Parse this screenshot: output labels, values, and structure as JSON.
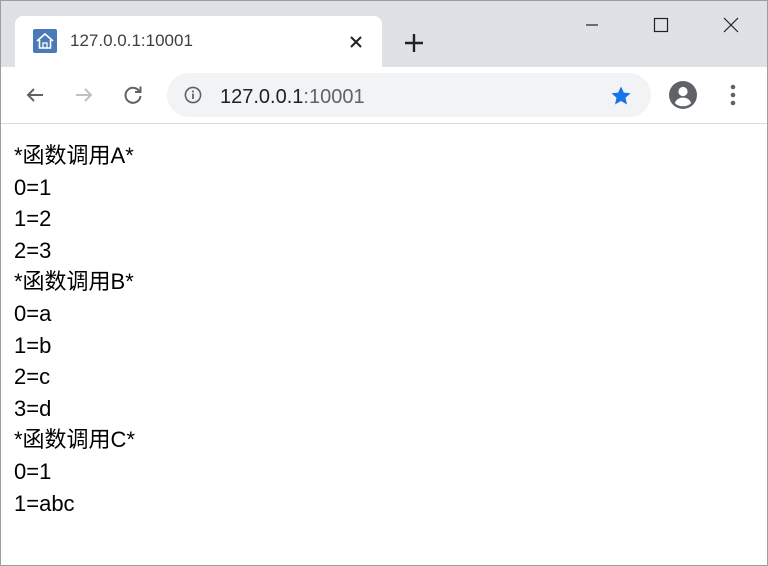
{
  "browser": {
    "tab": {
      "title": "127.0.0.1:10001",
      "favicon": "home-icon",
      "close_glyph": "✕"
    },
    "new_tab_icon": "plus-icon",
    "window_controls": [
      "minimize-icon",
      "maximize-icon",
      "close-icon"
    ],
    "toolbar": {
      "back_icon": "arrow-left-icon",
      "forward_icon": "arrow-right-icon",
      "reload_icon": "reload-icon",
      "address": {
        "host": "127.0.0.1",
        "port": ":10001",
        "info_icon": "info-icon",
        "bookmark_icon": "star-icon",
        "bookmark_color": "#1a73e8"
      },
      "profile_icon": "account-icon",
      "menu_icon": "kebab-menu-icon"
    },
    "colors": {
      "tabstrip": "#dee1e6",
      "omnibox": "#f1f3f4",
      "favicon_bg": "#4a7ab8"
    }
  },
  "page": {
    "lines": [
      "*函数调用A*",
      "0=1",
      "1=2",
      "2=3",
      "*函数调用B*",
      "0=a",
      "1=b",
      "2=c",
      "3=d",
      "*函数调用C*",
      "0=1",
      "1=abc"
    ]
  }
}
